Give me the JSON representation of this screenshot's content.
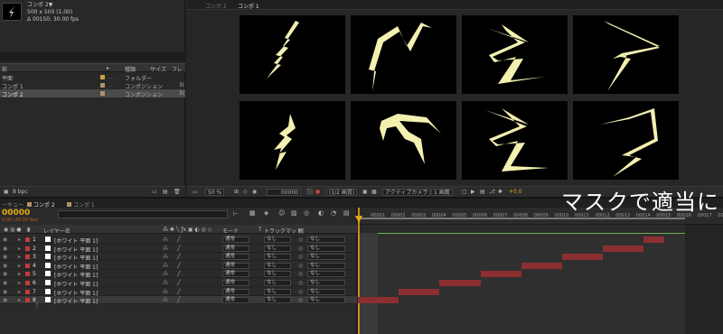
{
  "project": {
    "comp_name": "コンポ 2▼",
    "comp_size": "500 x 500 (1.00)",
    "comp_duration": "Δ 00150, 30.00 fps",
    "columns": {
      "name": "前",
      "type": "種類",
      "size": "サイズ",
      "frame": "フレ"
    },
    "items": [
      {
        "name": "平面",
        "type": "フォルダー",
        "swatch": "#c9a63a",
        "size": ""
      },
      {
        "name": "コンポ 1",
        "type": "コンポジション",
        "swatch": "#b3926b",
        "size": "3("
      },
      {
        "name": "コンポ 2",
        "type": "コンポジション",
        "swatch": "#b3926b",
        "size": "3("
      }
    ],
    "bpc": "8 bpc"
  },
  "viewer": {
    "tab": "コンポ 1",
    "zoom": "50 %",
    "timecode": "00000",
    "resolution": "(1/2 画質)",
    "camera": "アクティブカメラ",
    "view": "1 画面",
    "exposure": "+0.0"
  },
  "timeline": {
    "tabs": [
      "ーキュー",
      "コンポ 2",
      "コンポ 1"
    ],
    "current_time": "00000",
    "fps_label": "0:00 (30.00 fps)",
    "columns": {
      "layer_name": "レイヤー名",
      "mode": "モード",
      "t": "T",
      "trkmat": "トラックマット",
      "parent": "親"
    },
    "layers": [
      {
        "num": "1",
        "name": "[ホワイト 平面 1]",
        "mode": "通常",
        "trkmat": "なし",
        "parent": "なし",
        "bar_start_frame": 14,
        "bar_end_frame": 15
      },
      {
        "num": "2",
        "name": "[ホワイト 平面 1]",
        "mode": "通常",
        "trkmat": "なし",
        "parent": "なし",
        "bar_start_frame": 12,
        "bar_end_frame": 14
      },
      {
        "num": "3",
        "name": "[ホワイト 平面 1]",
        "mode": "通常",
        "trkmat": "なし",
        "parent": "なし",
        "bar_start_frame": 10,
        "bar_end_frame": 12
      },
      {
        "num": "4",
        "name": "[ホワイト 平面 1]",
        "mode": "通常",
        "trkmat": "なし",
        "parent": "なし",
        "bar_start_frame": 8,
        "bar_end_frame": 10
      },
      {
        "num": "5",
        "name": "[ホワイト 平面 1]",
        "mode": "通常",
        "trkmat": "なし",
        "parent": "なし",
        "bar_start_frame": 6,
        "bar_end_frame": 8
      },
      {
        "num": "6",
        "name": "[ホワイト 平面 1]",
        "mode": "通常",
        "trkmat": "なし",
        "parent": "なし",
        "bar_start_frame": 4,
        "bar_end_frame": 6
      },
      {
        "num": "7",
        "name": "[ホワイト 平面 1]",
        "mode": "通常",
        "trkmat": "なし",
        "parent": "なし",
        "bar_start_frame": 2,
        "bar_end_frame": 4
      },
      {
        "num": "8",
        "name": "[ホワイト 平面 1]",
        "mode": "通常",
        "trkmat": "なし",
        "parent": "なし",
        "bar_start_frame": 0,
        "bar_end_frame": 2
      }
    ],
    "ruler": [
      "00001",
      "00002",
      "00003",
      "00004",
      "00005",
      "00006",
      "00007",
      "00008",
      "00009",
      "00010",
      "00011",
      "00012",
      "00013",
      "00014",
      "00015",
      "00016",
      "00017",
      "00018"
    ]
  },
  "caption": "マスクで適当に",
  "colors": {
    "bolt": "#f3f0b0",
    "bar": "#8c2f30",
    "label_red": "#c23a3a",
    "accent": "#e6a817"
  }
}
